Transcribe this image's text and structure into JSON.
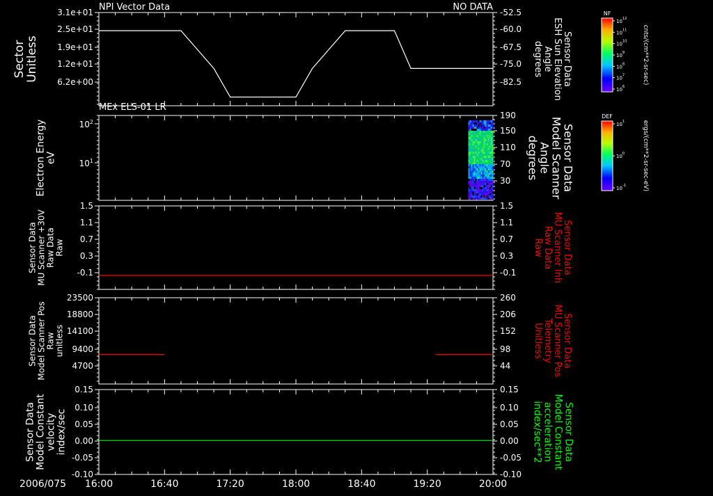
{
  "header": {
    "left_title": "NPI Vector Data",
    "right_title": "NO DATA"
  },
  "panel2_title": "MEx ELS-01 LR",
  "time_axis": {
    "date_label": "2006/075",
    "ticks": [
      "16:00",
      "16:40",
      "17:20",
      "18:00",
      "18:40",
      "19:20",
      "20:00"
    ]
  },
  "colors": {
    "white": "#ffffff",
    "red": "#ff0000",
    "green": "#00ff00",
    "background": "#000000"
  },
  "colorbars": [
    {
      "title": "NF",
      "label": "cnts/(cm**2-sr-sec)",
      "tick_labels": [
        "10^12",
        "10^11",
        "10^10",
        "10^9",
        "10^8",
        "10^7",
        "10^6"
      ]
    },
    {
      "title": "DEF",
      "label": "ergs/(cm**2-sr-sec-eV)",
      "tick_labels": [
        "10^1",
        "10^0",
        "10^-1"
      ]
    }
  ],
  "chart_data": [
    {
      "type": "line",
      "left_label": [
        "Sector",
        "Unitless"
      ],
      "left_ticks": [
        "3.1e+01",
        "2.5e+01",
        "1.9e+01",
        "1.2e+01",
        "6.2e+00"
      ],
      "right_label": [
        "Sensor Data",
        "ESH Sun Elevation",
        "Angle",
        "degrees"
      ],
      "right_ticks": [
        "-52.5",
        "-60.0",
        "-67.5",
        "-75.0",
        "-82.5"
      ],
      "ylim": [
        -90,
        -52.5
      ],
      "x": [
        "16:00",
        "16:30",
        "16:50",
        "17:10",
        "17:20",
        "18:00",
        "18:10",
        "18:30",
        "18:50",
        "19:00",
        "19:10",
        "20:00"
      ],
      "series": [
        {
          "values": [
            -59.8,
            -59.8,
            -59.8,
            -75,
            -86.5,
            -86.5,
            -75,
            -59.8,
            -59.8,
            -59.8,
            -75,
            -75
          ]
        }
      ]
    },
    {
      "type": "heatmap",
      "left_label": [
        "Electron Energy",
        "eV"
      ],
      "left_ticks": [
        "10^2",
        "10^1"
      ],
      "right_label": [
        "Sensor Data",
        "Model Scanner",
        "Angle",
        "degrees"
      ],
      "right_ticks": [
        "190",
        "150",
        "110",
        "70",
        "30"
      ],
      "ylim_eV": [
        1.3,
        200
      ],
      "x_range": [
        "19:45",
        "20:00"
      ],
      "y_range_eV": [
        1.5,
        150
      ]
    },
    {
      "type": "line",
      "left_label": [
        "Sensor Data",
        "MU Scanner +30V",
        "Raw Data",
        "Raw"
      ],
      "left_ticks": [
        "1.5",
        "1.1",
        "0.7",
        "0.3",
        "-0.1"
      ],
      "right_label": [
        "Sensor Data",
        "MU Scanner Inh",
        "Raw Data",
        "Raw"
      ],
      "right_ticks": [
        "1.5",
        "1.1",
        "0.7",
        "0.3",
        "-0.1"
      ],
      "ylim": [
        -0.3,
        1.5
      ],
      "series": [
        {
          "x": [
            "16:00",
            "20:00"
          ],
          "values": [
            0.0,
            0.0
          ]
        }
      ]
    },
    {
      "type": "line",
      "left_label": [
        "Sensor Data",
        "Model Scanner Pos",
        "Raw",
        "unitless"
      ],
      "left_ticks": [
        "23500",
        "18800",
        "14100",
        "9400",
        "4700"
      ],
      "right_label": [
        "Sensor Data",
        "MU Scanner Pos",
        "Telemetry",
        "Unitless"
      ],
      "right_ticks": [
        "260",
        "206",
        "152",
        "98",
        "44"
      ],
      "ylim": [
        0,
        23500
      ],
      "series": [
        {
          "x": [
            "16:00",
            "16:40"
          ],
          "values": [
            8000,
            8000
          ]
        },
        {
          "x": [
            "19:25",
            "20:00"
          ],
          "values": [
            8000,
            8000
          ]
        }
      ]
    },
    {
      "type": "line",
      "left_label": [
        "Sensor Data",
        "Model Constant",
        "velocity",
        "index/sec"
      ],
      "left_ticks": [
        "0.15",
        "0.10",
        "0.05",
        "0.00",
        "-0.05",
        "-0.10"
      ],
      "right_label": [
        "Sensor Data",
        "Model Constant",
        "acceleration",
        "index/sec**2"
      ],
      "right_ticks": [
        "0.15",
        "0.10",
        "0.05",
        "0.00",
        "-0.05",
        "-0.10"
      ],
      "ylim": [
        -0.1,
        0.15
      ],
      "series": [
        {
          "x": [
            "16:00",
            "20:00"
          ],
          "values": [
            0.0,
            0.0
          ]
        }
      ]
    }
  ]
}
